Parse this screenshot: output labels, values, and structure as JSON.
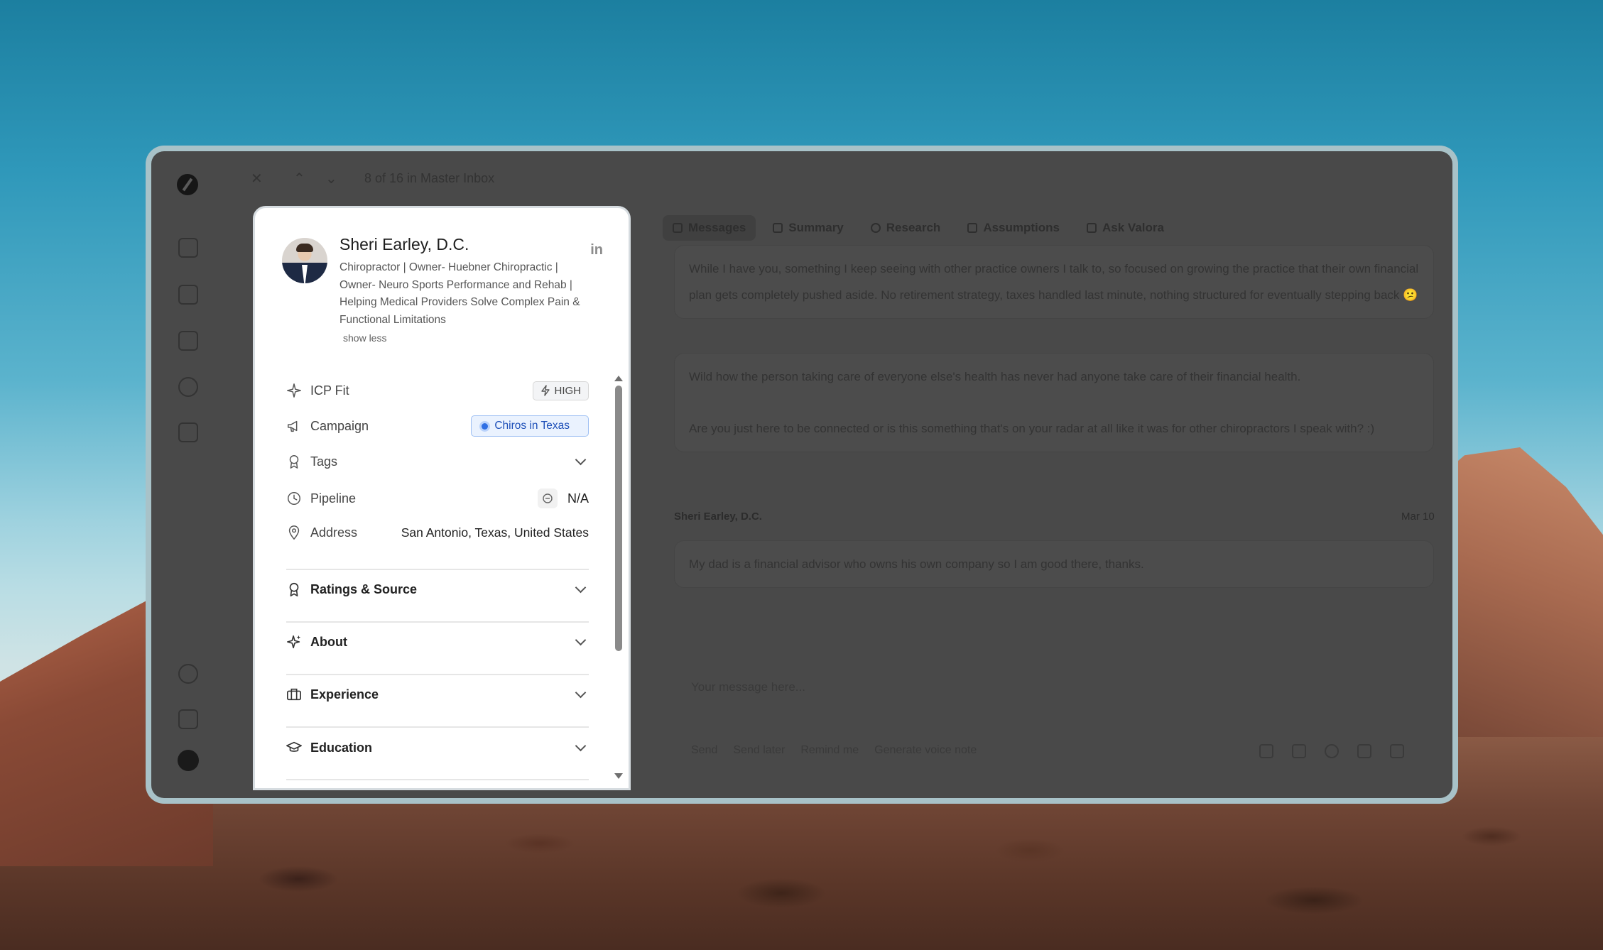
{
  "window": {
    "topbar": {
      "position_text": "8 of 16 in Master Inbox"
    },
    "tabs": [
      {
        "label": "Messages",
        "icon": "mail-icon"
      },
      {
        "label": "Summary",
        "icon": "doc-icon"
      },
      {
        "label": "Research",
        "icon": "search-icon"
      },
      {
        "label": "Assumptions",
        "icon": "pin-icon"
      },
      {
        "label": "Ask Valora",
        "icon": "sparkle-icon"
      }
    ],
    "messages": [
      {
        "text": "While I have you, something I keep seeing with other practice owners I talk to, so focused on growing the practice that their own financial plan gets completely pushed aside. No retirement strategy, taxes handled last minute, nothing structured for eventually stepping back 😕"
      },
      {
        "text": "Wild how the person taking care of everyone else's health has never had anyone take care of their financial health."
      },
      {
        "text": "Are you just here to be connected or is this something that's on your radar at all like it was for other chiropractors I speak with? :)"
      },
      {
        "sender": "Sheri Earley, D.C.",
        "date": "Mar 10",
        "text": "My dad is a financial advisor who owns his own company so I am good there, thanks."
      }
    ],
    "composer": {
      "placeholder": "Your message here...",
      "actions": [
        "Send",
        "Send later",
        "Remind me",
        "Generate voice note"
      ]
    }
  },
  "profile": {
    "name": "Sheri Earley, D.C.",
    "headline": "Chiropractor | Owner- Huebner Chiropractic | Owner- Neuro Sports Performance and Rehab | Helping Medical Providers Solve Complex Pain & Functional Limitations",
    "show_less": "show less",
    "linkedin_label": "in",
    "fields": {
      "icp_fit": {
        "label": "ICP Fit",
        "value": "HIGH"
      },
      "campaign": {
        "label": "Campaign",
        "value": "Chiros in Texas"
      },
      "tags": {
        "label": "Tags"
      },
      "pipeline": {
        "label": "Pipeline",
        "value": "N/A"
      },
      "address": {
        "label": "Address",
        "value": "San Antonio, Texas, United States"
      }
    },
    "sections": [
      {
        "label": "Ratings & Source"
      },
      {
        "label": "About"
      },
      {
        "label": "Experience"
      },
      {
        "label": "Education"
      }
    ]
  },
  "colors": {
    "campaign_badge_bg": "#eaf2fe",
    "campaign_badge_text": "#1d4fb8",
    "window_dim": "#494949"
  }
}
